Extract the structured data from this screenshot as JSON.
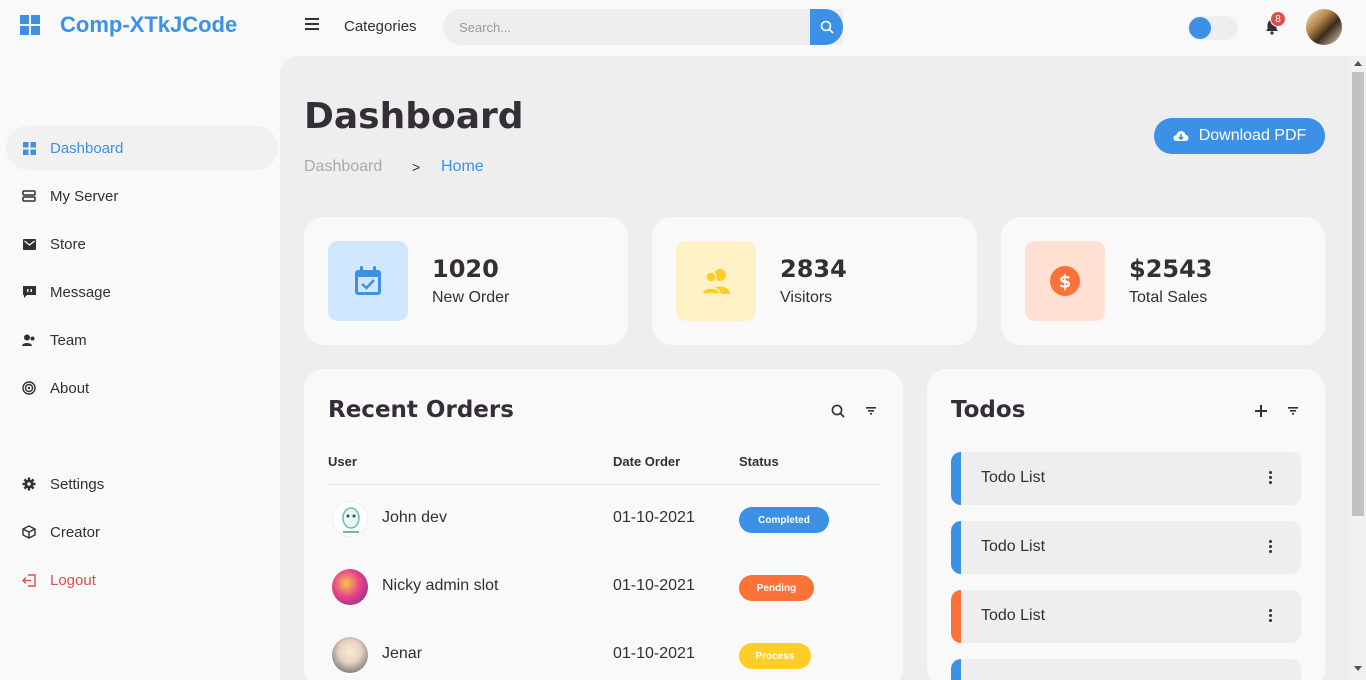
{
  "brand": {
    "name": "Comp-XTkJCode",
    "icon": "windows-logo-icon"
  },
  "topnav": {
    "categories_label": "Categories",
    "search_placeholder": "Search...",
    "notification_count": "8",
    "accent_color": "#3c91e6"
  },
  "sidebar": {
    "items": [
      {
        "label": "Dashboard",
        "icon": "dashboard-icon"
      },
      {
        "label": "My Server",
        "icon": "server-icon"
      },
      {
        "label": "Store",
        "icon": "store-icon"
      },
      {
        "label": "Message",
        "icon": "message-icon"
      },
      {
        "label": "Team",
        "icon": "team-icon"
      },
      {
        "label": "About",
        "icon": "about-icon"
      }
    ],
    "bottom_items": [
      {
        "label": "Settings",
        "icon": "gear-icon"
      },
      {
        "label": "Creator",
        "icon": "cube-icon"
      },
      {
        "label": "Logout",
        "icon": "logout-icon"
      }
    ]
  },
  "main": {
    "title": "Dashboard",
    "breadcrumb": [
      "Dashboard",
      "Home"
    ],
    "breadcrumb_separator": ">",
    "download_label": "Download PDF"
  },
  "stats": [
    {
      "value": "1020",
      "label": "New Order",
      "icon": "calendar-check-icon",
      "color": "#3c91e6"
    },
    {
      "value": "2834",
      "label": "Visitors",
      "icon": "users-icon",
      "color": "#ffce26"
    },
    {
      "value": "$2543",
      "label": "Total Sales",
      "icon": "dollar-circle-icon",
      "color": "#fd7238"
    }
  ],
  "orders": {
    "title": "Recent Orders",
    "headers": [
      "User",
      "Date Order",
      "Status"
    ],
    "rows": [
      {
        "user": "John dev",
        "date": "01-10-2021",
        "status": "Completed",
        "status_color": "#3c91e6"
      },
      {
        "user": "Nicky admin slot",
        "date": "01-10-2021",
        "status": "Pending",
        "status_color": "#fd7238"
      },
      {
        "user": "Jenar",
        "date": "01-10-2021",
        "status": "Process",
        "status_color": "#ffce26"
      }
    ]
  },
  "todos": {
    "title": "Todos",
    "items": [
      {
        "label": "Todo List",
        "color": "#3c91e6"
      },
      {
        "label": "Todo List",
        "color": "#3c91e6"
      },
      {
        "label": "Todo List",
        "color": "#fd7238"
      },
      {
        "label": "",
        "color": "#3c91e6"
      }
    ]
  }
}
